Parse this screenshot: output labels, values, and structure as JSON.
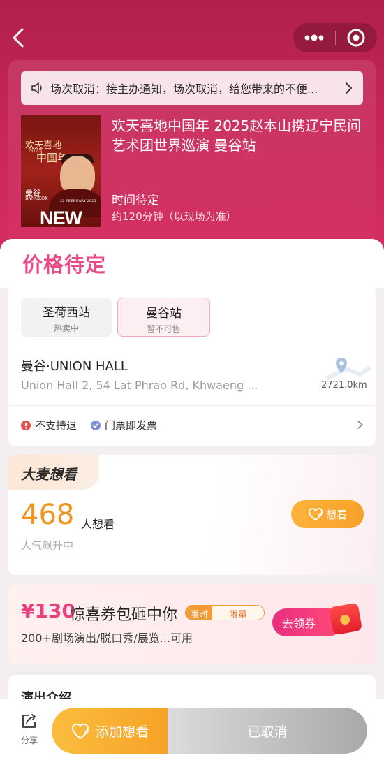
{
  "notice": {
    "text": "场次取消：接主办通知，场次取消，给您带来的不便..."
  },
  "show": {
    "title": "欢天喜地中国年 2025赵本山携辽宁民间艺术团世界巡演 曼谷站",
    "time": "时间待定",
    "duration": "约120分钟（以现场为准）",
    "poster": {
      "line1": "欢天喜地",
      "line2": "中国年",
      "year": "2025",
      "city": "曼谷",
      "city_en": "BANGKOK",
      "date": "22 FEBRUARY 2025",
      "banner": "NEW YEAR"
    }
  },
  "price": "价格待定",
  "cities": [
    {
      "name": "圣荷西站",
      "status": "热卖中"
    },
    {
      "name": "曼谷站",
      "status": "暂不可售"
    }
  ],
  "venue": {
    "name": "曼谷·UNION HALL",
    "address": "Union Hall 2, 54 Lat Phrao Rd, Khwaeng ...",
    "distance": "2721.0km"
  },
  "policies": {
    "refund": "不支持退",
    "invoice": "门票即发票"
  },
  "want": {
    "logo": "大麦想看",
    "count": "468",
    "unit": "人想看",
    "trend": "人气飙升中",
    "button": "想看"
  },
  "coupon": {
    "amount": "¥130",
    "title": "惊喜券包砸中你",
    "tag_a": "限时",
    "tag_b": "限量",
    "desc": "200+剧场演出/脱口秀/展览...可用",
    "button": "去领券"
  },
  "intro": {
    "title": "演出介绍"
  },
  "bottom": {
    "share": "分享",
    "add_want": "添加想看",
    "status": "已取消"
  },
  "colors": {
    "hero": "#c72558",
    "accent": "#e94b89",
    "orange": "#f7a327"
  }
}
